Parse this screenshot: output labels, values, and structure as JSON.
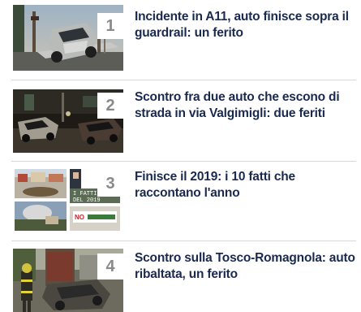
{
  "articles": [
    {
      "rank": "1",
      "title": "Incidente in A11, auto finisce sopra il guardrail: un ferito",
      "image": "crashed-car-on-guardrail-photo"
    },
    {
      "rank": "2",
      "title": "Scontro fra due auto che escono di strada in via Valgimigli: due feriti",
      "image": "night-car-crash-photo"
    },
    {
      "rank": "3",
      "title": "Finisce il 2019: i 10 fatti che raccontano l'anno",
      "image": "year-in-review-collage",
      "image_caption": "I FATTI DEL 2019"
    },
    {
      "rank": "4",
      "title": "Scontro sulla Tosco-Romagnola: auto ribaltata, un ferito",
      "image": "overturned-car-firefighter-photo"
    }
  ],
  "colors": {
    "title": "#1a2a4f",
    "rank": "#8a8a8a",
    "divider": "#d8d8d8"
  }
}
